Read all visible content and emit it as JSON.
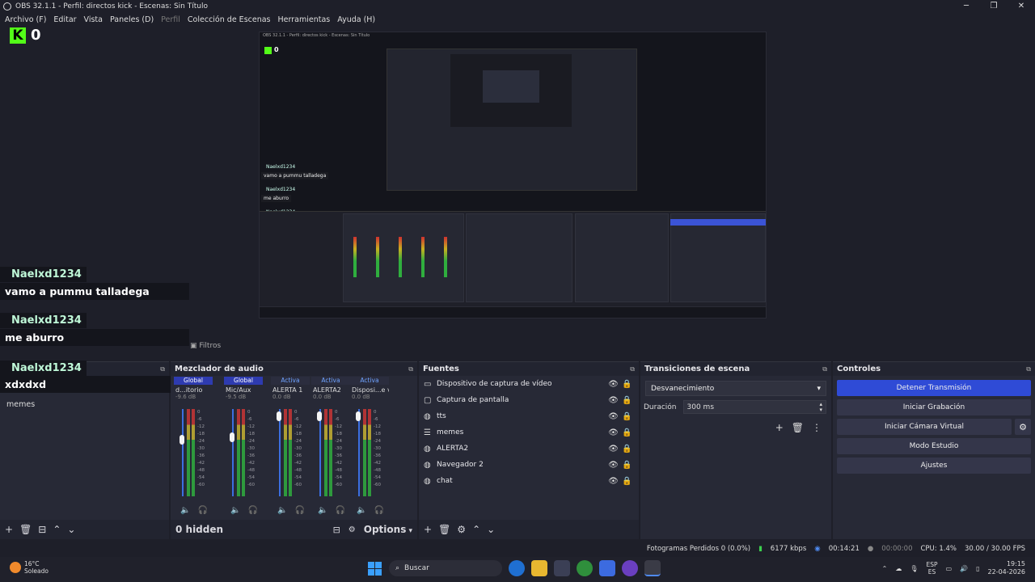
{
  "window": {
    "title": "OBS 32.1.1 - Perfil: directos kick - Escenas: Sin Título",
    "controls": [
      "─",
      "❐",
      "✕"
    ]
  },
  "menu": [
    "Archivo (F)",
    "Editar",
    "Vista",
    "Paneles (D)",
    "Perfil",
    "Colección de Escenas",
    "Herramientas",
    "Ayuda (H)"
  ],
  "overlay": {
    "kick_count": "0",
    "kick_letter": "K",
    "nested_title": "OBS 32.1.1 - Perfil: directos kick - Escenas: Sin Título",
    "chat": [
      {
        "user": "Naelxd1234",
        "message": "vamo a pummu talladega"
      },
      {
        "user": "Naelxd1234",
        "message": "me aburro"
      },
      {
        "user": "Naelxd1234",
        "message": "xdxdxd"
      }
    ]
  },
  "scenes": {
    "filters_label": "Filtros",
    "items": [
      "memes"
    ]
  },
  "mixer": {
    "title": "Mezclador de audio",
    "strips": [
      {
        "head": "Global",
        "name": "d...itorio",
        "db": "-9.6 dB",
        "level": 0.3
      },
      {
        "head": "Global",
        "name": "Mic/Aux",
        "db": "-9.5 dB",
        "level": 0.27
      },
      {
        "head": "Activa",
        "name": "ALERTA 1",
        "db": "0.0 dB",
        "level": 0.03
      },
      {
        "head": "Activa",
        "name": "ALERTA2",
        "db": "0.0 dB",
        "level": 0.03
      },
      {
        "head": "Activa",
        "name": "Disposi...e video",
        "db": "0.0 dB",
        "level": 0.03
      }
    ],
    "ticks": [
      "0",
      "-6",
      "-12",
      "-18",
      "-24",
      "-30",
      "-36",
      "-42",
      "-48",
      "-54",
      "-60"
    ],
    "hidden": "0 hidden",
    "options": "Options"
  },
  "sources": {
    "title": "Fuentes",
    "items": [
      {
        "icon": "display",
        "label": "Dispositivo de captura de vídeo"
      },
      {
        "icon": "monitor",
        "label": "Captura de pantalla"
      },
      {
        "icon": "globe",
        "label": "tts"
      },
      {
        "icon": "list",
        "label": "memes"
      },
      {
        "icon": "globe",
        "label": "ALERTA2"
      },
      {
        "icon": "globe",
        "label": "Navegador 2"
      },
      {
        "icon": "globe",
        "label": "chat"
      }
    ]
  },
  "transitions": {
    "title": "Transiciones de escena",
    "selected": "Desvanecimiento",
    "duration_label": "Duración",
    "duration_value": "300 ms"
  },
  "controls": {
    "title": "Controles",
    "stop_stream": "Detener Transmisión",
    "start_record": "Iniciar Grabación",
    "start_virtualcam": "Iniciar Cámara Virtual",
    "studio_mode": "Modo Estudio",
    "settings": "Ajustes"
  },
  "status": {
    "dropped_frames": "Fotogramas Perdidos 0 (0.0%)",
    "bitrate": "6177 kbps",
    "stream_time": "00:14:21",
    "record_time": "00:00:00",
    "cpu": "CPU: 1.4%",
    "fps": "30.00 / 30.00 FPS"
  },
  "taskbar": {
    "temperature": "16°C",
    "weather": "Soleado",
    "search": "Buscar",
    "lang_top": "ESP",
    "lang_bottom": "ES",
    "time": "19:15",
    "date": "22-04-2026"
  },
  "colors": {
    "accent_blue": "#2f4bd6",
    "kick_green": "#53fc18",
    "meter_green": "#2fae3e"
  }
}
